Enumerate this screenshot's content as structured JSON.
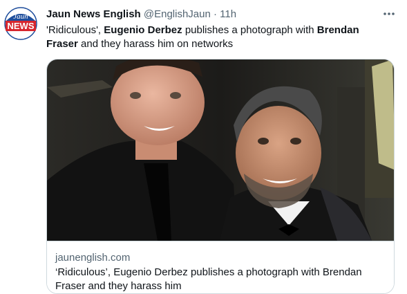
{
  "tweet": {
    "author": {
      "display_name": "Jaun News English",
      "handle": "@EnglishJaun",
      "separator": "·",
      "time": "11h",
      "avatar_text_top": "Jaun",
      "avatar_text_bottom": "NEWS"
    },
    "text": {
      "p1": "'Ridiculous',",
      "b1": "Eugenio Derbez",
      "p2": "publishes a photograph with",
      "b2": "Brendan Fraser",
      "p3": "and they harass him on networks"
    },
    "card": {
      "domain": "jaunenglish.com",
      "title": "‘Ridiculous’, Eugenio Derbez publishes a photograph with Brendan Fraser and they harass him"
    }
  },
  "colors": {
    "text_primary": "#0f1419",
    "text_secondary": "#536471",
    "border": "#cfd9de",
    "avatar_red": "#d7262e",
    "avatar_blue": "#1f4e9c"
  },
  "icons": {
    "more": "more-horizontal-icon"
  }
}
